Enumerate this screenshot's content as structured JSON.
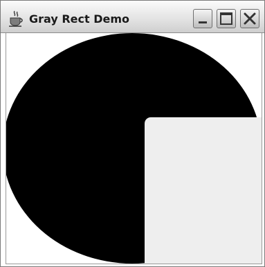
{
  "window": {
    "title": "Gray Rect Demo",
    "app_icon": "java-cup-icon",
    "controls": {
      "minimize_icon": "minimize-icon",
      "maximize_icon": "maximize-icon",
      "close_icon": "close-icon"
    }
  },
  "canvas": {
    "shapes": [
      {
        "kind": "ellipse",
        "color": "#000000"
      },
      {
        "kind": "rounded-rectangle",
        "color": "#eeeeee"
      }
    ]
  }
}
